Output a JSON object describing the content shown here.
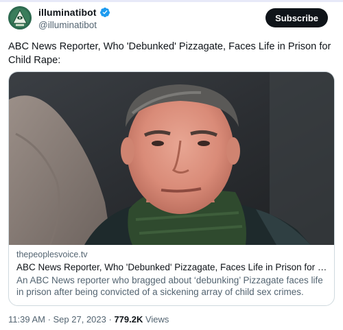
{
  "account": {
    "display_name": "illuminatibot",
    "handle": "@illuminatibot",
    "subscribe_label": "Subscribe"
  },
  "tweet": {
    "text": "ABC News Reporter, Who 'Debunked' Pizzagate, Faces Life in Prison for Child Rape:",
    "timestamp": "11:39 AM · Sep 27, 2023",
    "separator": " · ",
    "views_count": "779.2K",
    "views_label": " Views"
  },
  "card": {
    "domain": "thepeoplesvoice.tv",
    "title": "ABC News Reporter, Who 'Debunked' Pizzagate, Faces Life in Prison for Child ...",
    "description": "An ABC News reporter who bragged about ‘debunking’ Pizzagate faces life in prison after being convicted of a sickening array of child sex crimes."
  },
  "colors": {
    "accent_verified": "#1d9bf0",
    "subscribe_bg": "#0f1419",
    "muted_text": "#536471"
  },
  "icons": [
    "pyramid-eye-avatar",
    "verified-badge-icon"
  ]
}
